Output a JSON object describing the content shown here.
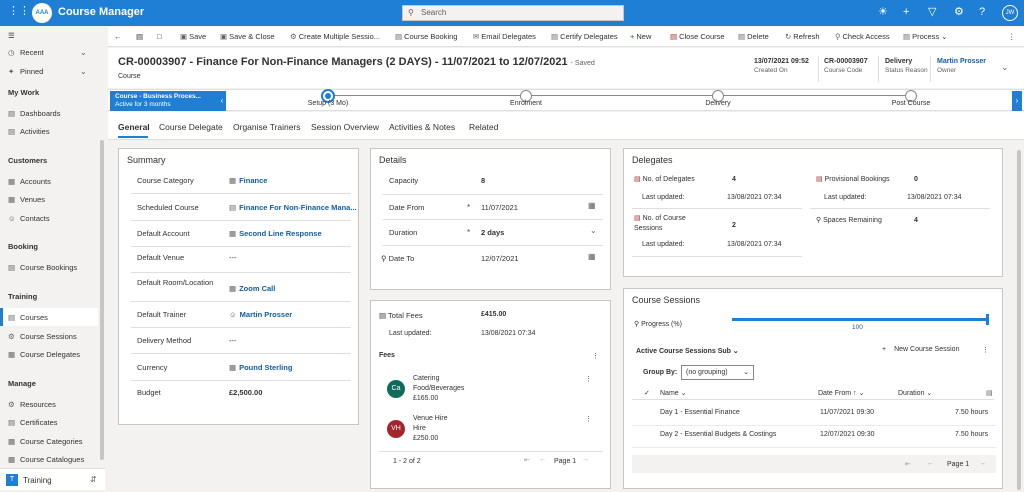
{
  "app": {
    "logo_text": "AAA",
    "name": "Course Manager",
    "search_placeholder": "Search",
    "user_initials": "JW"
  },
  "top_icons": [
    "lightbulb-icon",
    "plus-icon",
    "filter-icon",
    "gear-icon",
    "help-icon"
  ],
  "sidebar": {
    "recent": "Recent",
    "pinned": "Pinned",
    "mywork": "My Work",
    "dashboards": "Dashboards",
    "activities": "Activities",
    "customers": "Customers",
    "accounts": "Accounts",
    "venues": "Venues",
    "contacts": "Contacts",
    "booking": "Booking",
    "course_bookings": "Course Bookings",
    "training": "Training",
    "courses": "Courses",
    "course_sessions": "Course Sessions",
    "course_delegates": "Course Delegates",
    "manage": "Manage",
    "resources": "Resources",
    "certificates": "Certificates",
    "course_categories": "Course Categories",
    "course_catalogues": "Course Catalogues",
    "area_letter": "T",
    "area_name": "Training"
  },
  "commands": {
    "save": "Save",
    "save_close": "Save & Close",
    "create_multiple": "Create Multiple Sessio...",
    "course_booking": "Course Booking",
    "email_delegates": "Email Delegates",
    "certify_delegates": "Certify Delegates",
    "new": "New",
    "close_course": "Close Course",
    "delete": "Delete",
    "refresh": "Refresh",
    "check_access": "Check Access",
    "process": "Process"
  },
  "record": {
    "title": "CR-00003907 - Finance For Non-Finance Managers (2 DAYS) - 11/07/2021 to 12/07/2021",
    "saved": "- Saved",
    "entity": "Course",
    "created_on": "13/07/2021 09:52",
    "created_on_label": "Created On",
    "course_code": "CR-00003907",
    "course_code_label": "Course Code",
    "status_reason": "Delivery",
    "status_reason_label": "Status Reason",
    "owner": "Martin Prosser",
    "owner_label": "Owner"
  },
  "bpf": {
    "name": "Course - Business Proces...",
    "active": "Active for 3 months",
    "stages": [
      "Setup  (3 Mo)",
      "Enrolment",
      "Delivery",
      "Post Course"
    ]
  },
  "tabs": [
    "General",
    "Course Delegate",
    "Organise Trainers",
    "Session Overview",
    "Activities & Notes",
    "Related"
  ],
  "summary": {
    "title": "Summary",
    "fields": [
      {
        "label": "Course Category",
        "value": "Finance",
        "link": true
      },
      {
        "label": "Scheduled Course",
        "value": "Finance For Non-Finance Mana...",
        "link": true
      },
      {
        "label": "Default Account",
        "value": "Second Line Response",
        "link": true
      },
      {
        "label": "Default Venue",
        "value": "---",
        "link": false
      },
      {
        "label": "Default Room/Location",
        "value": "Zoom Call",
        "link": true
      },
      {
        "label": "Default Trainer",
        "value": "Martin Prosser",
        "link": true
      },
      {
        "label": "Delivery Method",
        "value": "---",
        "link": false
      },
      {
        "label": "Currency",
        "value": "Pound Sterling",
        "link": true
      },
      {
        "label": "Budget",
        "value": "£2,500.00",
        "link": false
      }
    ]
  },
  "details": {
    "title": "Details",
    "capacity_label": "Capacity",
    "capacity": "8",
    "date_from_label": "Date From",
    "date_from": "11/07/2021",
    "duration_label": "Duration",
    "duration": "2 days",
    "date_to_label": "Date To",
    "date_to": "12/07/2021",
    "required": "*"
  },
  "fees": {
    "total_label": "Total Fees",
    "total": "£415.00",
    "updated_label": "Last updated:",
    "updated": "13/08/2021 07:34",
    "fees_title": "Fees",
    "items": [
      {
        "initials": "Ca",
        "color": "#0f6b5c",
        "line1": "Catering",
        "line2": "Food/Beverages",
        "line3": "£165.00"
      },
      {
        "initials": "VH",
        "color": "#a4262c",
        "line1": "Venue Hire",
        "line2": "Hire",
        "line3": "£250.00"
      }
    ],
    "paging": "1 - 2 of 2",
    "page": "Page 1"
  },
  "delegates": {
    "title": "Delegates",
    "num_label": "No. of Delegates",
    "num": "4",
    "num_updated_label": "Last updated:",
    "num_updated": "13/08/2021 07:34",
    "sessions_label": "No. of Course Sessions",
    "sessions": "2",
    "sessions_updated_label": "Last updated:",
    "sessions_updated": "13/08/2021 07:34",
    "prov_label": "Provisional Bookings",
    "prov": "0",
    "prov_updated_label": "Last updated:",
    "prov_updated": "13/08/2021 07:34",
    "spaces_label": "Spaces Remaining",
    "spaces": "4"
  },
  "sessions": {
    "title": "Course Sessions",
    "progress_label": "Progress (%)",
    "progress": 100,
    "view": "Active Course Sessions Sub",
    "new": "New Course Session",
    "groupby_label": "Group By:",
    "groupby": "(no grouping)",
    "cols": [
      "Name",
      "Date From",
      "Duration"
    ],
    "rows": [
      {
        "name": "Day 1 - Essential Finance",
        "date": "11/07/2021 09:30",
        "duration": "7.50 hours"
      },
      {
        "name": "Day 2 - Essential Budgets & Costings",
        "date": "12/07/2021 09:30",
        "duration": "7.50 hours"
      }
    ],
    "page": "Page 1"
  }
}
